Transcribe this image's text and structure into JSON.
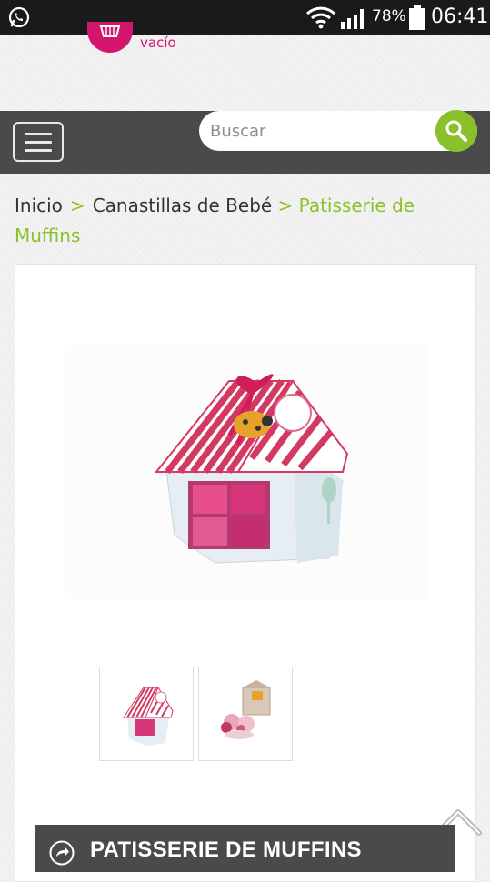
{
  "status_bar": {
    "battery_percent": "78%",
    "time": "06:41",
    "icons": [
      "whatsapp-icon",
      "wifi-icon",
      "signal-icon",
      "battery-icon"
    ]
  },
  "header": {
    "cart_status": "vacío",
    "cart_color": "#d4156d"
  },
  "search": {
    "placeholder": "Buscar",
    "button_color": "#8ac12a"
  },
  "breadcrumb": {
    "items": [
      "Inicio",
      "Canastillas de Bebé"
    ],
    "current": "Patisserie de Muffins",
    "separator": ">",
    "accent_color": "#8ac12a"
  },
  "product": {
    "title": "PATISSERIE DE MUFFINS",
    "thumbnails": [
      "thumbnail-1",
      "thumbnail-2"
    ]
  }
}
